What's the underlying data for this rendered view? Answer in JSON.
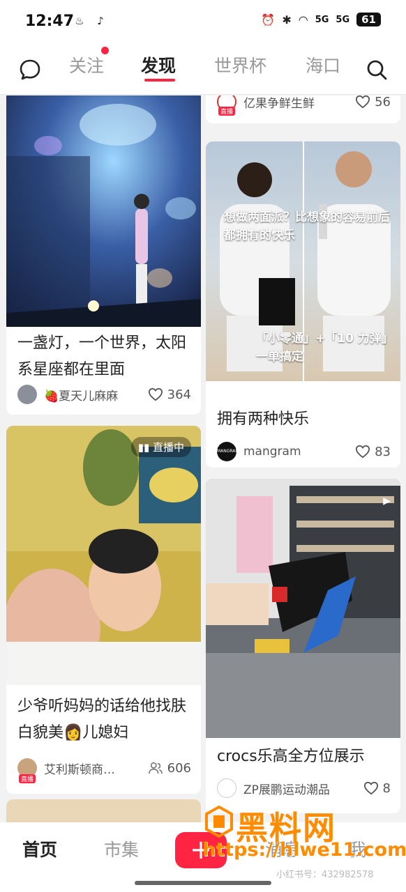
{
  "status_bar": {
    "time": "12:47",
    "battery": "61",
    "signal_1": "5G",
    "signal_2": "5G",
    "icons": [
      "tiktok-notification-icon",
      "alarm-icon",
      "bluetooth-icon",
      "wifi-icon"
    ]
  },
  "top_nav": {
    "tabs": [
      "关注",
      "发现",
      "世界杯",
      "海口"
    ],
    "active_tab": "发现",
    "accent_color": "#ff2442"
  },
  "feed": {
    "left": [
      {
        "title": "一盏灯，一个世界，太阳系星座都在里面",
        "author": "🍓夏天儿麻麻",
        "likes": "364"
      },
      {
        "title": "少爷听妈妈的话给他找肤白貌美👩儿媳妇",
        "author": "艾利斯顿商…",
        "viewers": "606",
        "live_badge": "直播中",
        "avatar_tag": "直播"
      }
    ],
    "right": [
      {
        "author": "亿果争鲜生鲜",
        "likes": "56",
        "avatar_tag": "直播"
      },
      {
        "title": "拥有两种快乐",
        "author": "mangram",
        "likes": "83",
        "overlay_top": "想做两面派？比想象的容易前后都拥有的快乐",
        "overlay_bottom": "「小零通」+「10 力弹」一单搞定",
        "book_label": "MANGRAM"
      },
      {
        "title": "crocs乐高全方位展示",
        "author": "ZP展鹏运动潮品",
        "likes": "8"
      }
    ]
  },
  "bottom_nav": {
    "items": [
      "首页",
      "市集",
      "消息",
      "我"
    ],
    "plus": "+"
  },
  "watermark": {
    "title": "黑料网",
    "url": "https://hlwe11.com",
    "id": "小红书号：432982578"
  }
}
